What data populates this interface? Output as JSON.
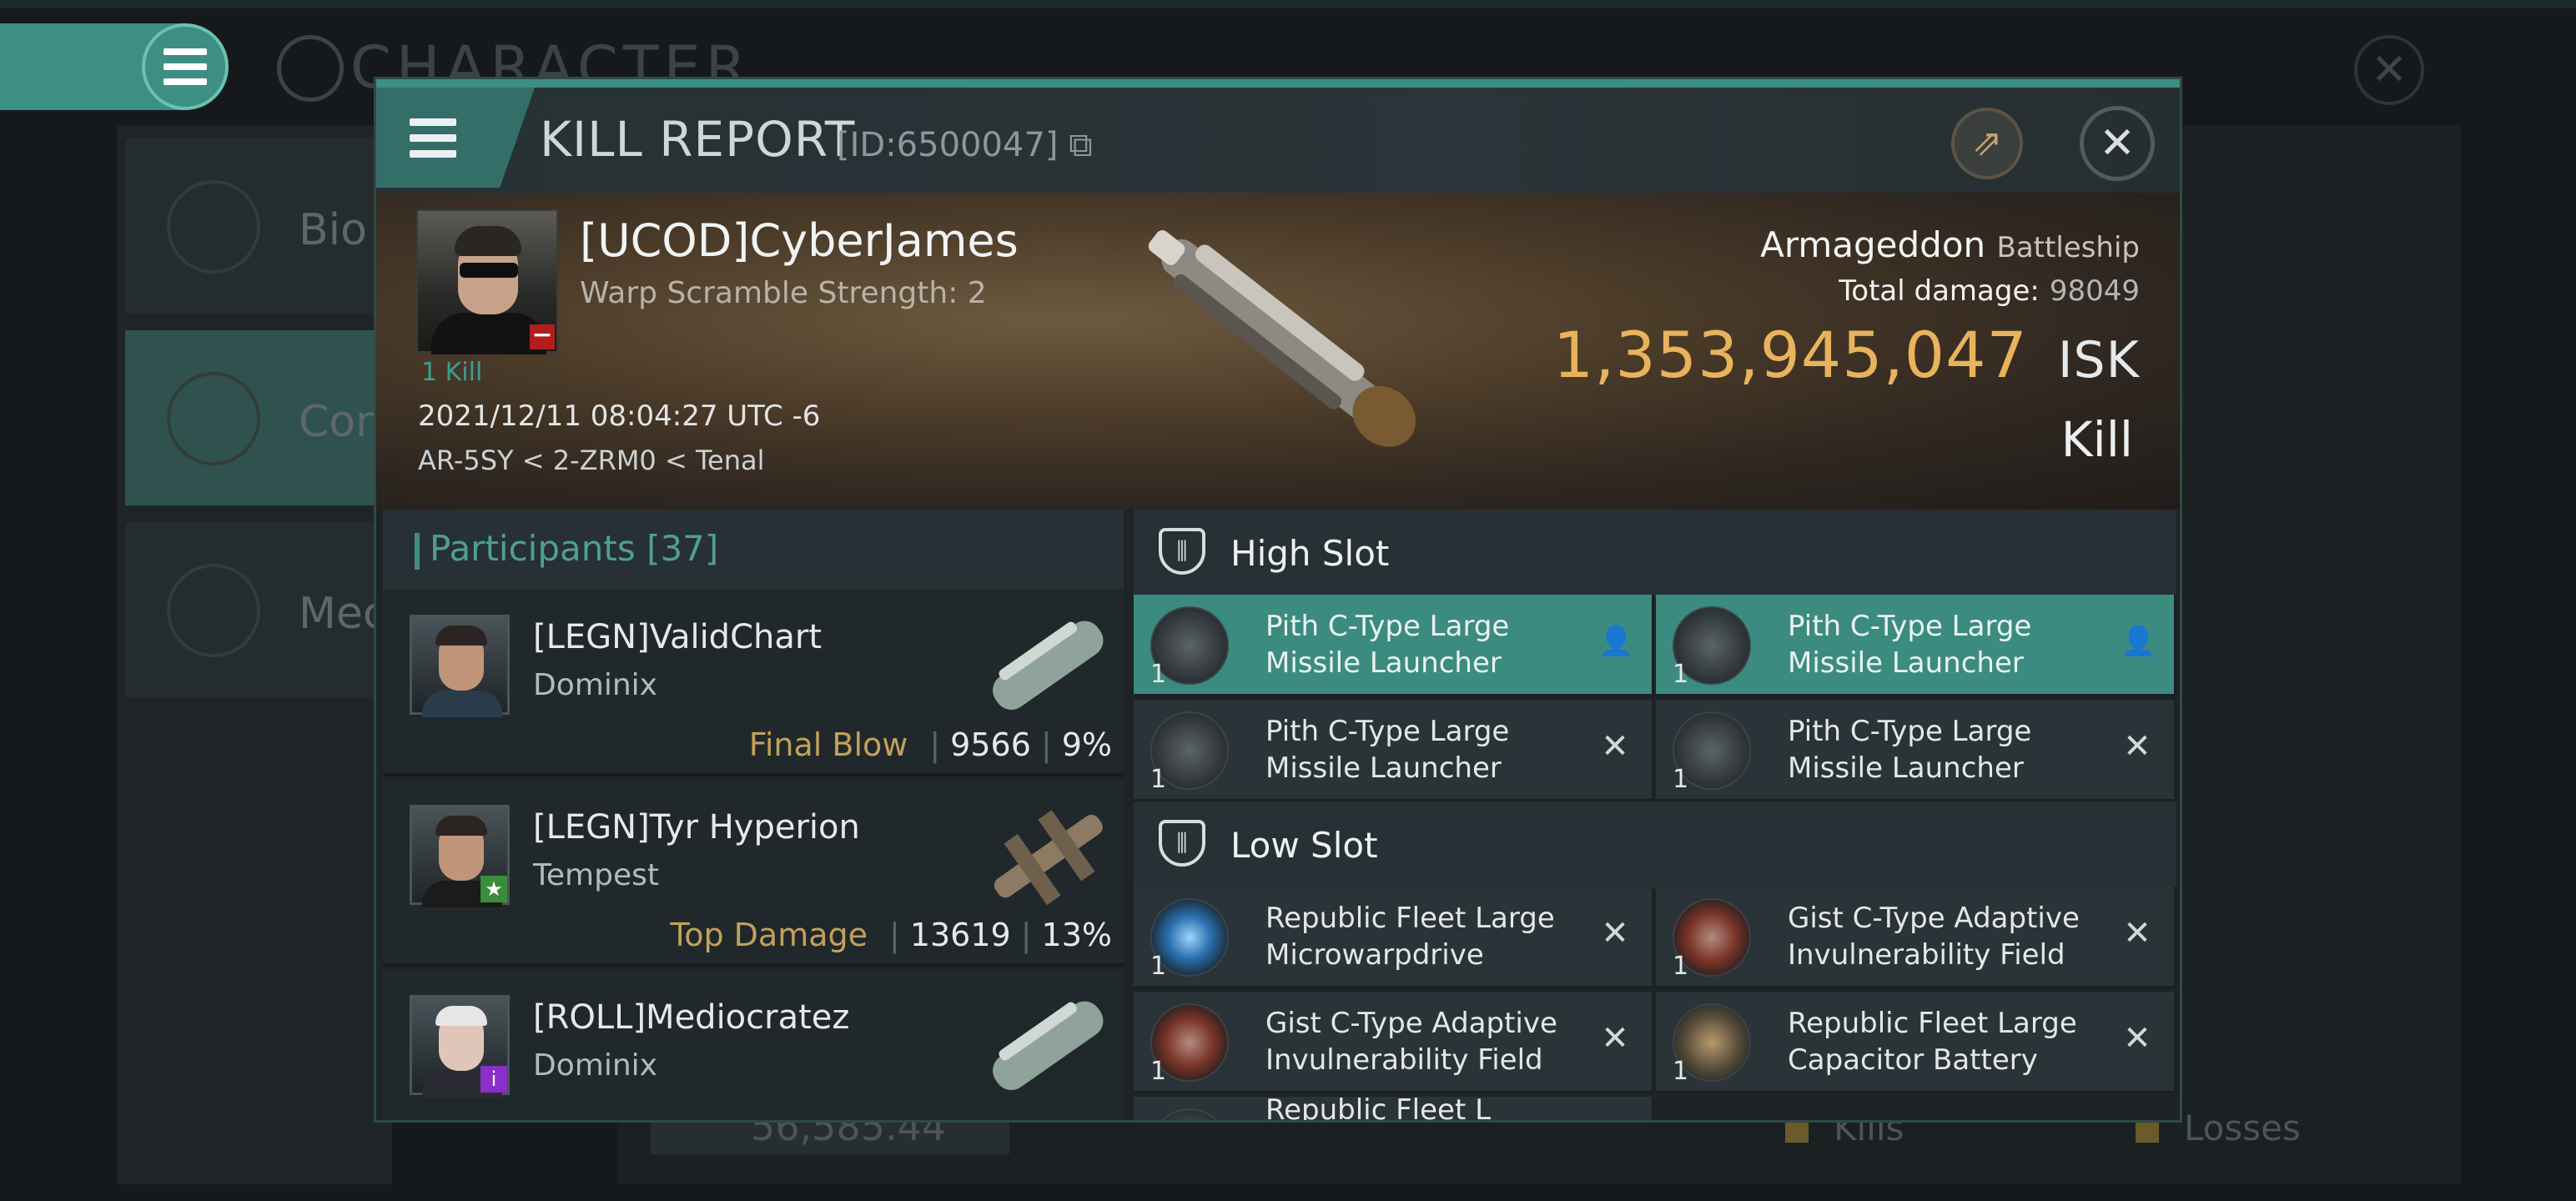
{
  "background": {
    "title": "CHARACTER",
    "menu": [
      "Bio",
      "Com",
      "Mec"
    ],
    "bottom_value": "56,585.44",
    "legend": [
      "Kills",
      "Losses"
    ]
  },
  "modal": {
    "title": "KILL REPORT",
    "id": "[ID:6500047]",
    "victim": {
      "name": "[UCOD]CyberJames",
      "warp": "Warp Scramble Strength: 2",
      "kills": "1 Kill",
      "date": "2021/12/11 08:04:27 UTC -6",
      "location": "AR-5SY < 2-ZRM0 < Tenal"
    },
    "ship": {
      "name": "Armageddon",
      "class": "Battleship",
      "total_damage_label": "Total damage:",
      "total_damage": "98049",
      "isk_value": "1,353,945,047",
      "isk_unit": "ISK",
      "result": "Kill"
    },
    "participants": {
      "label": "Participants",
      "count": "[37]",
      "rows": [
        {
          "name": "[LEGN]ValidChart",
          "ship": "Dominix",
          "tag": "Final Blow",
          "damage": "9566",
          "percent": "9%"
        },
        {
          "name": "[LEGN]Tyr Hyperion",
          "ship": "Tempest",
          "tag": "Top Damage",
          "damage": "13619",
          "percent": "13%"
        },
        {
          "name": "[ROLL]Mediocratez",
          "ship": "Dominix"
        }
      ]
    },
    "high_slot": {
      "label": "High Slot",
      "items": [
        {
          "name": "Pith C-Type Large Missile Launcher",
          "qty": "1"
        },
        {
          "name": "Pith C-Type Large Missile Launcher",
          "qty": "1"
        },
        {
          "name": "Pith C-Type Large Missile Launcher",
          "qty": "1"
        },
        {
          "name": "Pith C-Type Large Missile Launcher",
          "qty": "1"
        }
      ]
    },
    "low_slot": {
      "label": "Low Slot",
      "items": [
        {
          "name": "Republic Fleet Large Microwarpdrive",
          "qty": "1"
        },
        {
          "name": "Gist C-Type Adaptive Invulnerability Field",
          "qty": "1"
        },
        {
          "name": "Gist C-Type Adaptive Invulnerability Field",
          "qty": "1"
        },
        {
          "name": "Republic Fleet Large Capacitor Battery",
          "qty": "1"
        },
        {
          "name": "Republic Fleet L"
        }
      ]
    }
  }
}
